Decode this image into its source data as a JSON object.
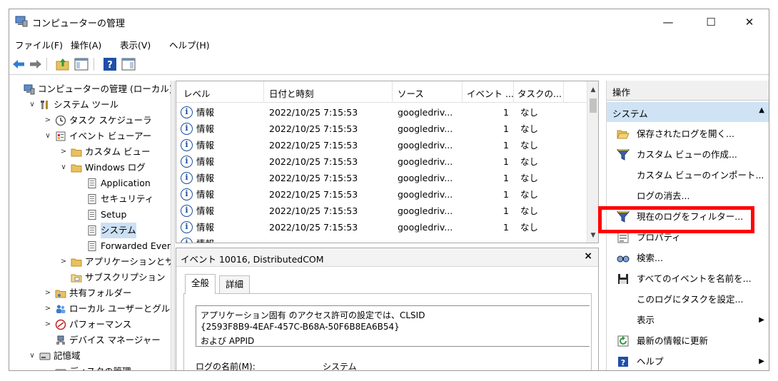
{
  "window": {
    "title": "コンピューターの管理",
    "controls": {
      "minimize": "—",
      "maximize": "☐",
      "close": "✕"
    }
  },
  "menu": [
    "ファイル(F)",
    "操作(A)",
    "表示(V)",
    "ヘルプ(H)"
  ],
  "tree": [
    {
      "label": "コンピューターの管理 (ローカル)",
      "icon": "computer-icon",
      "expander": ""
    },
    {
      "label": "システム ツール",
      "icon": "tools-icon",
      "expander": "∨"
    },
    {
      "label": "タスク スケジューラ",
      "icon": "clock-icon",
      "expander": ">"
    },
    {
      "label": "イベント ビューアー",
      "icon": "event-viewer-icon",
      "expander": "∨"
    },
    {
      "label": "カスタム ビュー",
      "icon": "folder-icon",
      "expander": ">"
    },
    {
      "label": "Windows ログ",
      "icon": "folder-icon",
      "expander": "∨"
    },
    {
      "label": "Application",
      "icon": "log-icon",
      "expander": ""
    },
    {
      "label": "セキュリティ",
      "icon": "log-icon",
      "expander": ""
    },
    {
      "label": "Setup",
      "icon": "log-icon",
      "expander": ""
    },
    {
      "label": "システム",
      "icon": "log-icon",
      "expander": "",
      "selected": true
    },
    {
      "label": "Forwarded Events",
      "icon": "log-icon",
      "expander": ""
    },
    {
      "label": "アプリケーションとサービス ログ",
      "icon": "folder-icon",
      "expander": ">"
    },
    {
      "label": "サブスクリプション",
      "icon": "subscription-icon",
      "expander": ""
    },
    {
      "label": "共有フォルダー",
      "icon": "shared-folder-icon",
      "expander": ">"
    },
    {
      "label": "ローカル ユーザーとグループ",
      "icon": "users-icon",
      "expander": ">"
    },
    {
      "label": "パフォーマンス",
      "icon": "performance-icon",
      "expander": ">"
    },
    {
      "label": "デバイス マネージャー",
      "icon": "device-manager-icon",
      "expander": ""
    },
    {
      "label": "記憶域",
      "icon": "storage-icon",
      "expander": "∨"
    },
    {
      "label": "ディスクの管理",
      "icon": "disk-icon",
      "expander": ""
    }
  ],
  "events": {
    "columns": [
      "レベル",
      "日付と時刻",
      "ソース",
      "イベント ...",
      "タスクの..."
    ],
    "rows": [
      {
        "level": "情報",
        "datetime": "2022/10/25 7:15:53",
        "source": "googledriv...",
        "event_id": "1",
        "task": "なし"
      },
      {
        "level": "情報",
        "datetime": "2022/10/25 7:15:53",
        "source": "googledriv...",
        "event_id": "1",
        "task": "なし"
      },
      {
        "level": "情報",
        "datetime": "2022/10/25 7:15:53",
        "source": "googledriv...",
        "event_id": "1",
        "task": "なし"
      },
      {
        "level": "情報",
        "datetime": "2022/10/25 7:15:53",
        "source": "googledriv...",
        "event_id": "1",
        "task": "なし"
      },
      {
        "level": "情報",
        "datetime": "2022/10/25 7:15:53",
        "source": "googledriv...",
        "event_id": "1",
        "task": "なし"
      },
      {
        "level": "情報",
        "datetime": "2022/10/25 7:15:53",
        "source": "googledriv...",
        "event_id": "1",
        "task": "なし"
      },
      {
        "level": "情報",
        "datetime": "2022/10/25 7:15:53",
        "source": "googledriv...",
        "event_id": "1",
        "task": "なし"
      },
      {
        "level": "情報",
        "datetime": "2022/10/25 7:15:53",
        "source": "googledriv...",
        "event_id": "1",
        "task": "なし"
      },
      {
        "level": "情報",
        "datetime": "",
        "source": "",
        "event_id": "",
        "task": ""
      }
    ]
  },
  "detail": {
    "title": "イベント 10016, DistributedCOM",
    "close": "×",
    "tabs": [
      "全般",
      "詳細"
    ],
    "description": [
      "アプリケーション固有 のアクセス許可の設定では、CLSID",
      "{2593F8B9-4EAF-457C-B68A-50F6B8EA6B54}",
      "および APPID"
    ],
    "log_name_label": "ログの名前(M):",
    "log_name_value": "システム"
  },
  "actions": {
    "header": "操作",
    "section": "システム",
    "items": [
      {
        "label": "保存されたログを開く...",
        "icon": "open-folder-icon"
      },
      {
        "label": "カスタム ビューの作成...",
        "icon": "filter-icon"
      },
      {
        "label": "カスタム ビューのインポート...",
        "icon": ""
      },
      {
        "label": "ログの消去...",
        "icon": ""
      },
      {
        "label": "現在のログをフィルター...",
        "icon": "filter-icon"
      },
      {
        "label": "プロパティ",
        "icon": "properties-icon"
      },
      {
        "label": "検索...",
        "icon": "find-icon"
      },
      {
        "label": "すべてのイベントを名前を...",
        "icon": "save-icon"
      },
      {
        "label": "このログにタスクを設定...",
        "icon": ""
      },
      {
        "label": "表示",
        "icon": "",
        "submenu": true
      },
      {
        "label": "最新の情報に更新",
        "icon": "refresh-icon"
      },
      {
        "label": "ヘルプ",
        "icon": "help-icon",
        "submenu": true
      }
    ]
  },
  "colors": {
    "highlight": "#ff0000",
    "selection": "#cce0f5",
    "info_icon": "#1a4f9a"
  }
}
